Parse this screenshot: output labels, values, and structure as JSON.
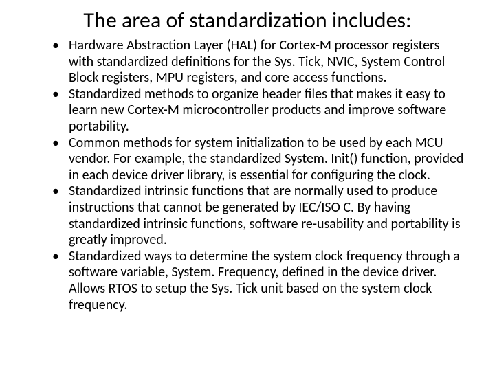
{
  "title": "The area of standardization includes:",
  "bullets": [
    "Hardware Abstraction Layer (HAL) for Cortex-M processor registers with standardized definitions for the Sys. Tick, NVIC, System Control Block registers, MPU registers, and core access functions.",
    "Standardized methods to organize header files that makes it easy to learn new Cortex-M microcontroller products and improve software portability.",
    "Common methods for system initialization to be used by each MCU vendor. For example, the standardized System. Init() function, provided in each device driver library, is essential for configuring the clock.",
    "Standardized intrinsic functions that are normally used to produce instructions that cannot be generated by IEC/ISO C. By having standardized intrinsic functions, software re-usability and portability is greatly improved.",
    "Standardized ways to determine the system clock frequency through a software variable, System. Frequency, defined in the device driver. Allows RTOS to setup the Sys. Tick unit based on the system clock frequency."
  ]
}
